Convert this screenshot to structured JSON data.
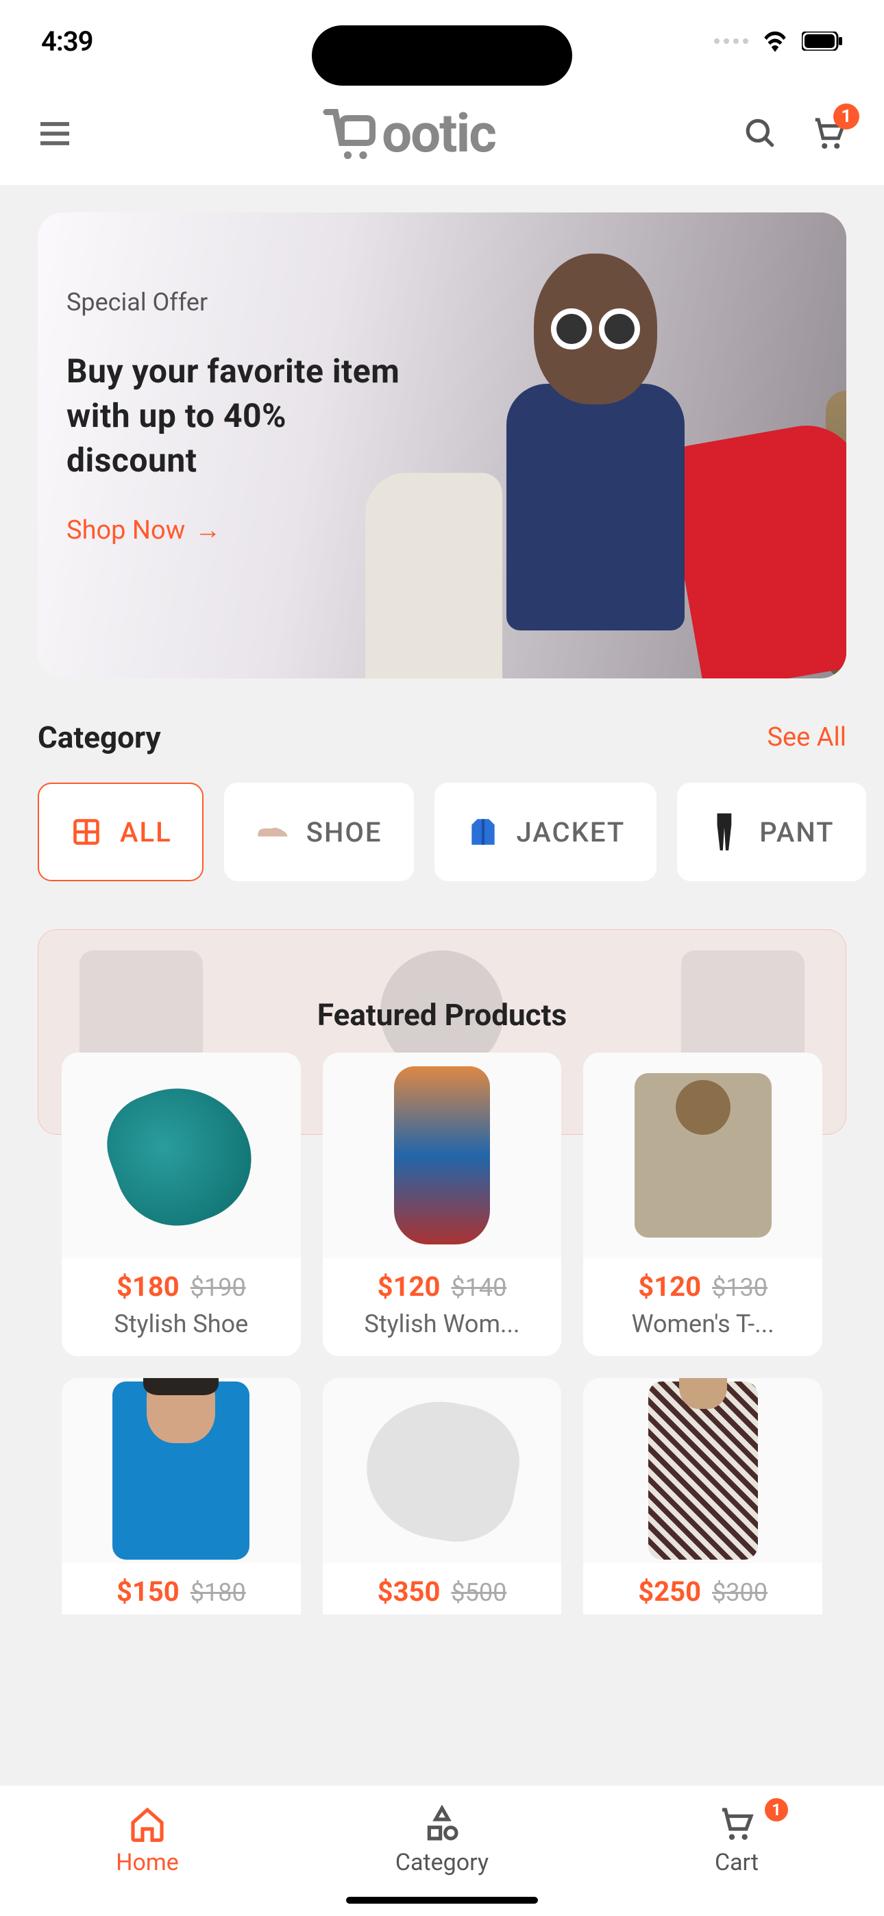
{
  "status": {
    "time": "4:39"
  },
  "header": {
    "logo": "ootic",
    "cart_badge": "1"
  },
  "banner": {
    "eyebrow": "Special Offer",
    "title": "Buy your favorite item with up to 40% discount",
    "cta": "Shop Now"
  },
  "category": {
    "heading": "Category",
    "see_all": "See All",
    "items": [
      {
        "label": "ALL"
      },
      {
        "label": "SHOE"
      },
      {
        "label": "JACKET"
      },
      {
        "label": "PANT"
      }
    ]
  },
  "featured": {
    "title": "Featured Products"
  },
  "products": [
    {
      "price": "$180",
      "old": "$190",
      "name": "Stylish Shoe"
    },
    {
      "price": "$120",
      "old": "$140",
      "name": "Stylish Wom..."
    },
    {
      "price": "$120",
      "old": "$130",
      "name": "Women's T-..."
    },
    {
      "price": "$150",
      "old": "$180",
      "name": ""
    },
    {
      "price": "$350",
      "old": "$500",
      "name": ""
    },
    {
      "price": "$250",
      "old": "$300",
      "name": ""
    }
  ],
  "nav": {
    "home": "Home",
    "category": "Category",
    "cart": "Cart",
    "cart_badge": "1"
  }
}
